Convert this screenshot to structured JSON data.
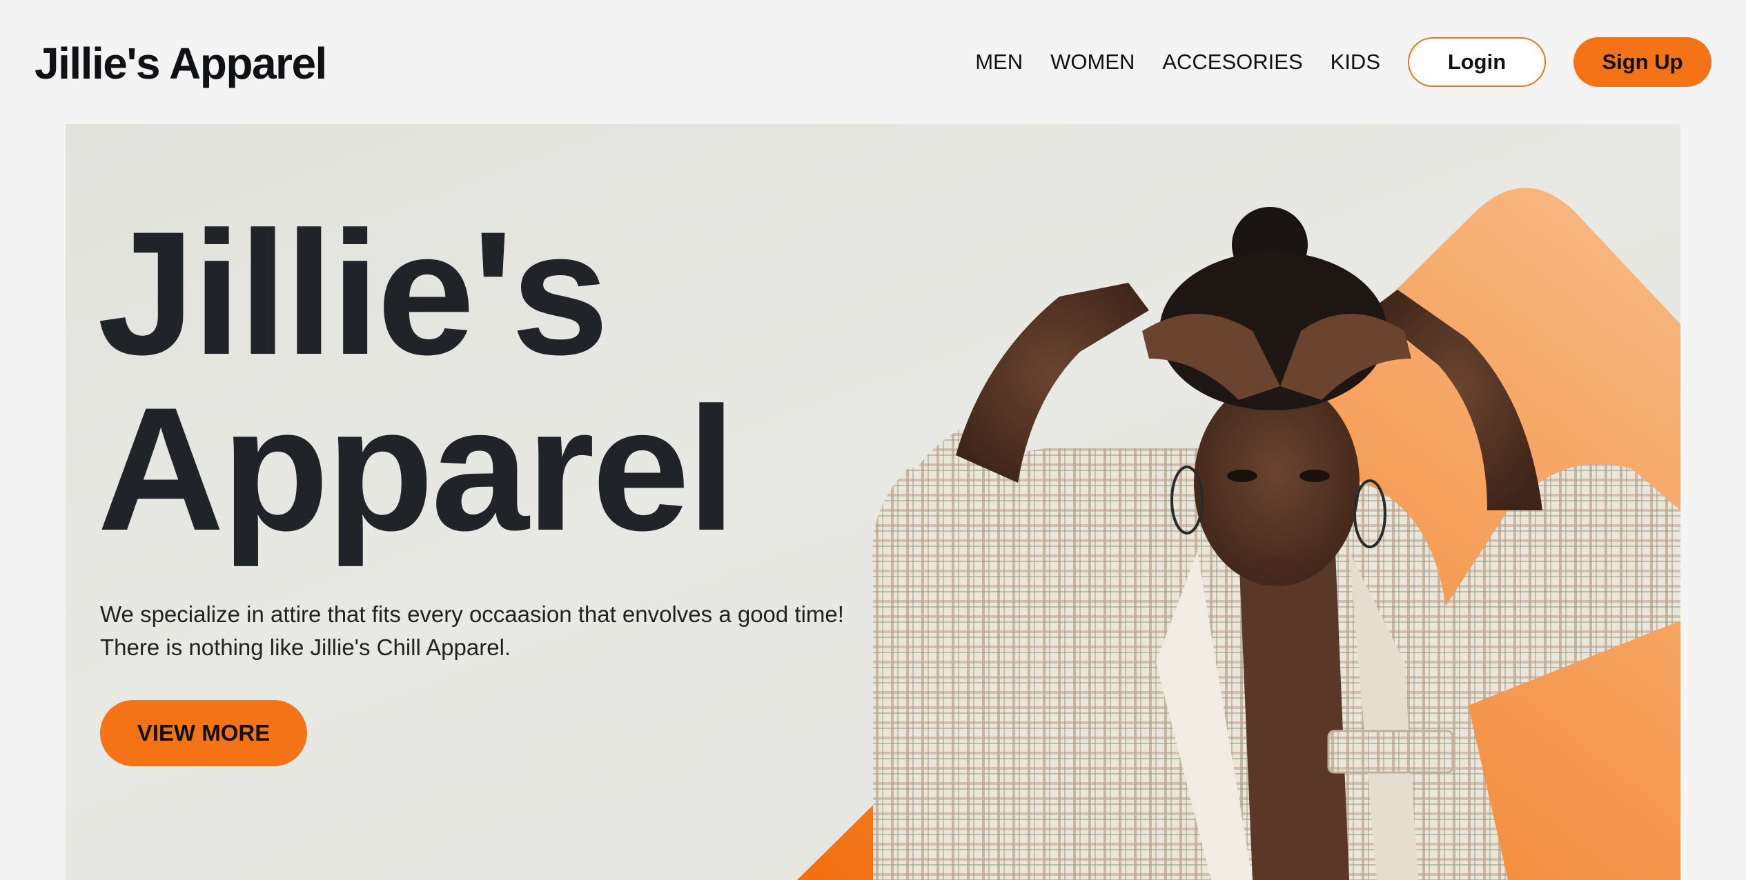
{
  "header": {
    "brand": "Jillie's Apparel",
    "nav": [
      "MEN",
      "WOMEN",
      "ACCESORIES",
      "KIDS"
    ],
    "login_label": "Login",
    "signup_label": "Sign Up"
  },
  "hero": {
    "title_line1": "Jillie's",
    "title_line2": "Apparel",
    "desc_line1": "We specialize in attire that fits every occaasion that envolves a good time!",
    "desc_line2": "There is nothing like Jillie's Chill Apparel.",
    "cta_label": "VIEW MORE"
  },
  "colors": {
    "accent": "#f37316",
    "background": "#f4f4f4",
    "hero_bg": "#e5e5e0",
    "text_dark": "#202328"
  },
  "icons": {
    "hero_image": "model-photo"
  }
}
